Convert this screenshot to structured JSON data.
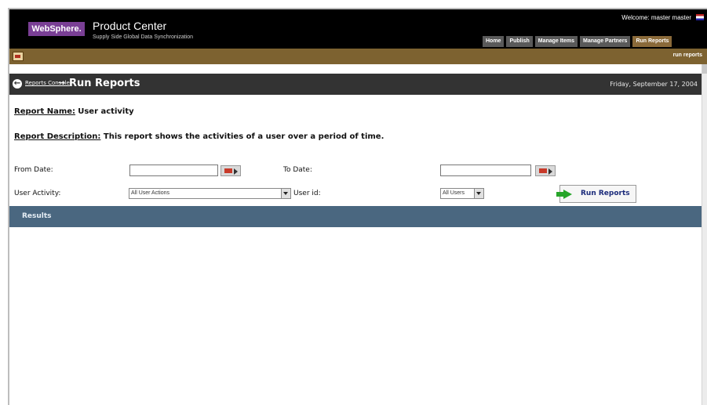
{
  "header": {
    "logo_text": "WebSphere.",
    "product_title": "Product Center",
    "product_subtitle": "Supply Side Global Data Synchronization",
    "welcome": "Welcome: master master",
    "tabs": [
      {
        "label": "Home"
      },
      {
        "label": "Publish"
      },
      {
        "label": "Manage Items"
      },
      {
        "label": "Manage Partners"
      },
      {
        "label": "Run Reports"
      }
    ]
  },
  "toolbar": {
    "link": "run reports"
  },
  "titlebar": {
    "breadcrumb": "Reports Console",
    "title": "Run Reports",
    "date": "Friday, September 17, 2004"
  },
  "report": {
    "name_label": "Report Name:",
    "name_value": "User activity",
    "desc_label": "Report Description:",
    "desc_value": "This report shows the activities of a user over a period of time."
  },
  "form": {
    "from_date_label": "From Date:",
    "from_date_value": "",
    "to_date_label": "To Date:",
    "to_date_value": "",
    "user_activity_label": "User Activity:",
    "user_activity_selected": "All User Actions",
    "user_id_label": "User id:",
    "user_id_selected": "All Users",
    "run_button": "Run Reports"
  },
  "results": {
    "label": "Results"
  },
  "colors": {
    "header": "#000000",
    "toolbar": "#7d6230",
    "titlebar": "#333333",
    "results": "#4a6780"
  }
}
